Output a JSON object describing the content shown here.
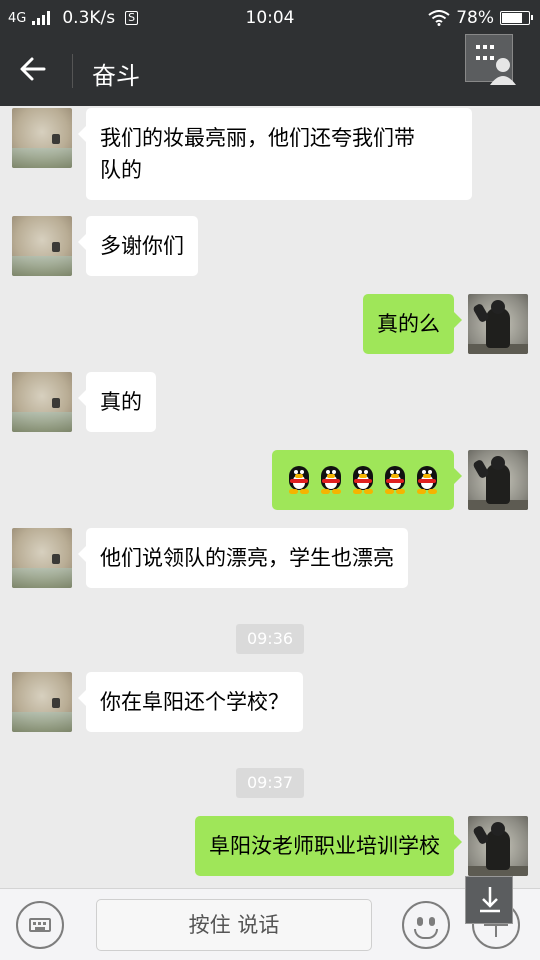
{
  "status_bar": {
    "network": "4G",
    "speed": "0.3K/s",
    "s_badge": "S",
    "time": "10:04",
    "battery": "78%",
    "battery_level": 0.78
  },
  "header": {
    "title": "奋斗"
  },
  "messages": [
    {
      "side": "left",
      "text_lines": [
        "我们的妆最亮丽，他们还夸我们带",
        "队的"
      ]
    },
    {
      "side": "left",
      "text": "多谢你们"
    },
    {
      "side": "right",
      "text": "真的么"
    },
    {
      "side": "left",
      "text": "真的"
    },
    {
      "side": "right",
      "emoji": "penguin-emoji",
      "count": 5
    },
    {
      "side": "left",
      "text": "他们说领队的漂亮，学生也漂亮"
    },
    {
      "timestamp": "09:36"
    },
    {
      "side": "left",
      "text": "你在阜阳还个学校？"
    },
    {
      "timestamp": "09:37"
    },
    {
      "side": "right",
      "text": "阜阳汝老师职业培训学校"
    }
  ],
  "input_bar": {
    "voice_label": "按住 说话"
  },
  "colors": {
    "header_bg": "#2f3133",
    "chat_bg": "#ebebeb",
    "bubble_sent": "#9fe659",
    "bubble_received": "#ffffff"
  }
}
